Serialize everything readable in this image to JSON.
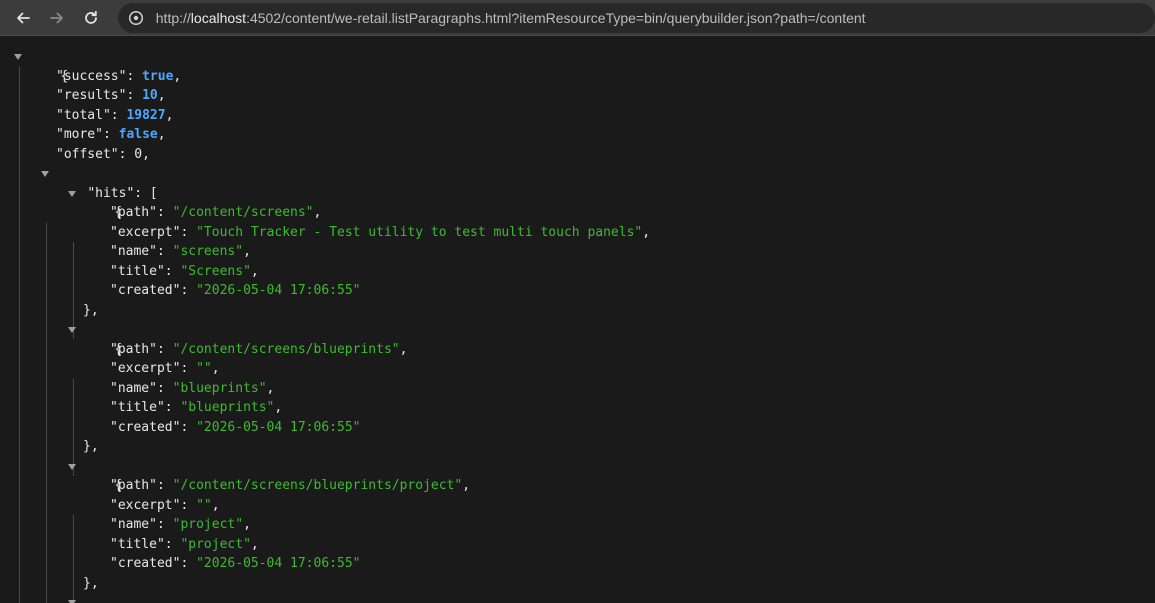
{
  "browser": {
    "url_prefix": "http://",
    "url_host": "localhost",
    "url_rest": ":4502/content/we-retail.listParagraphs.html?itemResourceType=bin/querybuilder.json?path=/content"
  },
  "json": {
    "success": "true",
    "results": "10",
    "total": "19827",
    "more": "false",
    "offset": "0",
    "hits_key": "\"hits\"",
    "hits": [
      {
        "path": "\"/content/screens\"",
        "excerpt": "\"Touch Tracker - Test utility to test multi touch panels\"",
        "name": "\"screens\"",
        "title": "\"Screens\"",
        "created": "\"2026-05-04 17:06:55\""
      },
      {
        "path": "\"/content/screens/blueprints\"",
        "excerpt": "\"\"",
        "name": "\"blueprints\"",
        "title": "\"blueprints\"",
        "created": "\"2026-05-04 17:06:55\""
      },
      {
        "path": "\"/content/screens/blueprints/project\"",
        "excerpt": "\"\"",
        "name": "\"project\"",
        "title": "\"project\"",
        "created": "\"2026-05-04 17:06:55\""
      }
    ]
  },
  "colors": {
    "string": "#3cbc2c",
    "literal": "#4ea7ff",
    "background": "#1a1a1a"
  },
  "icons": {
    "back": "arrow-left-icon",
    "forward": "arrow-right-icon",
    "reload": "reload-icon",
    "site": "site-info-icon",
    "collapse": "caret-down-icon"
  }
}
